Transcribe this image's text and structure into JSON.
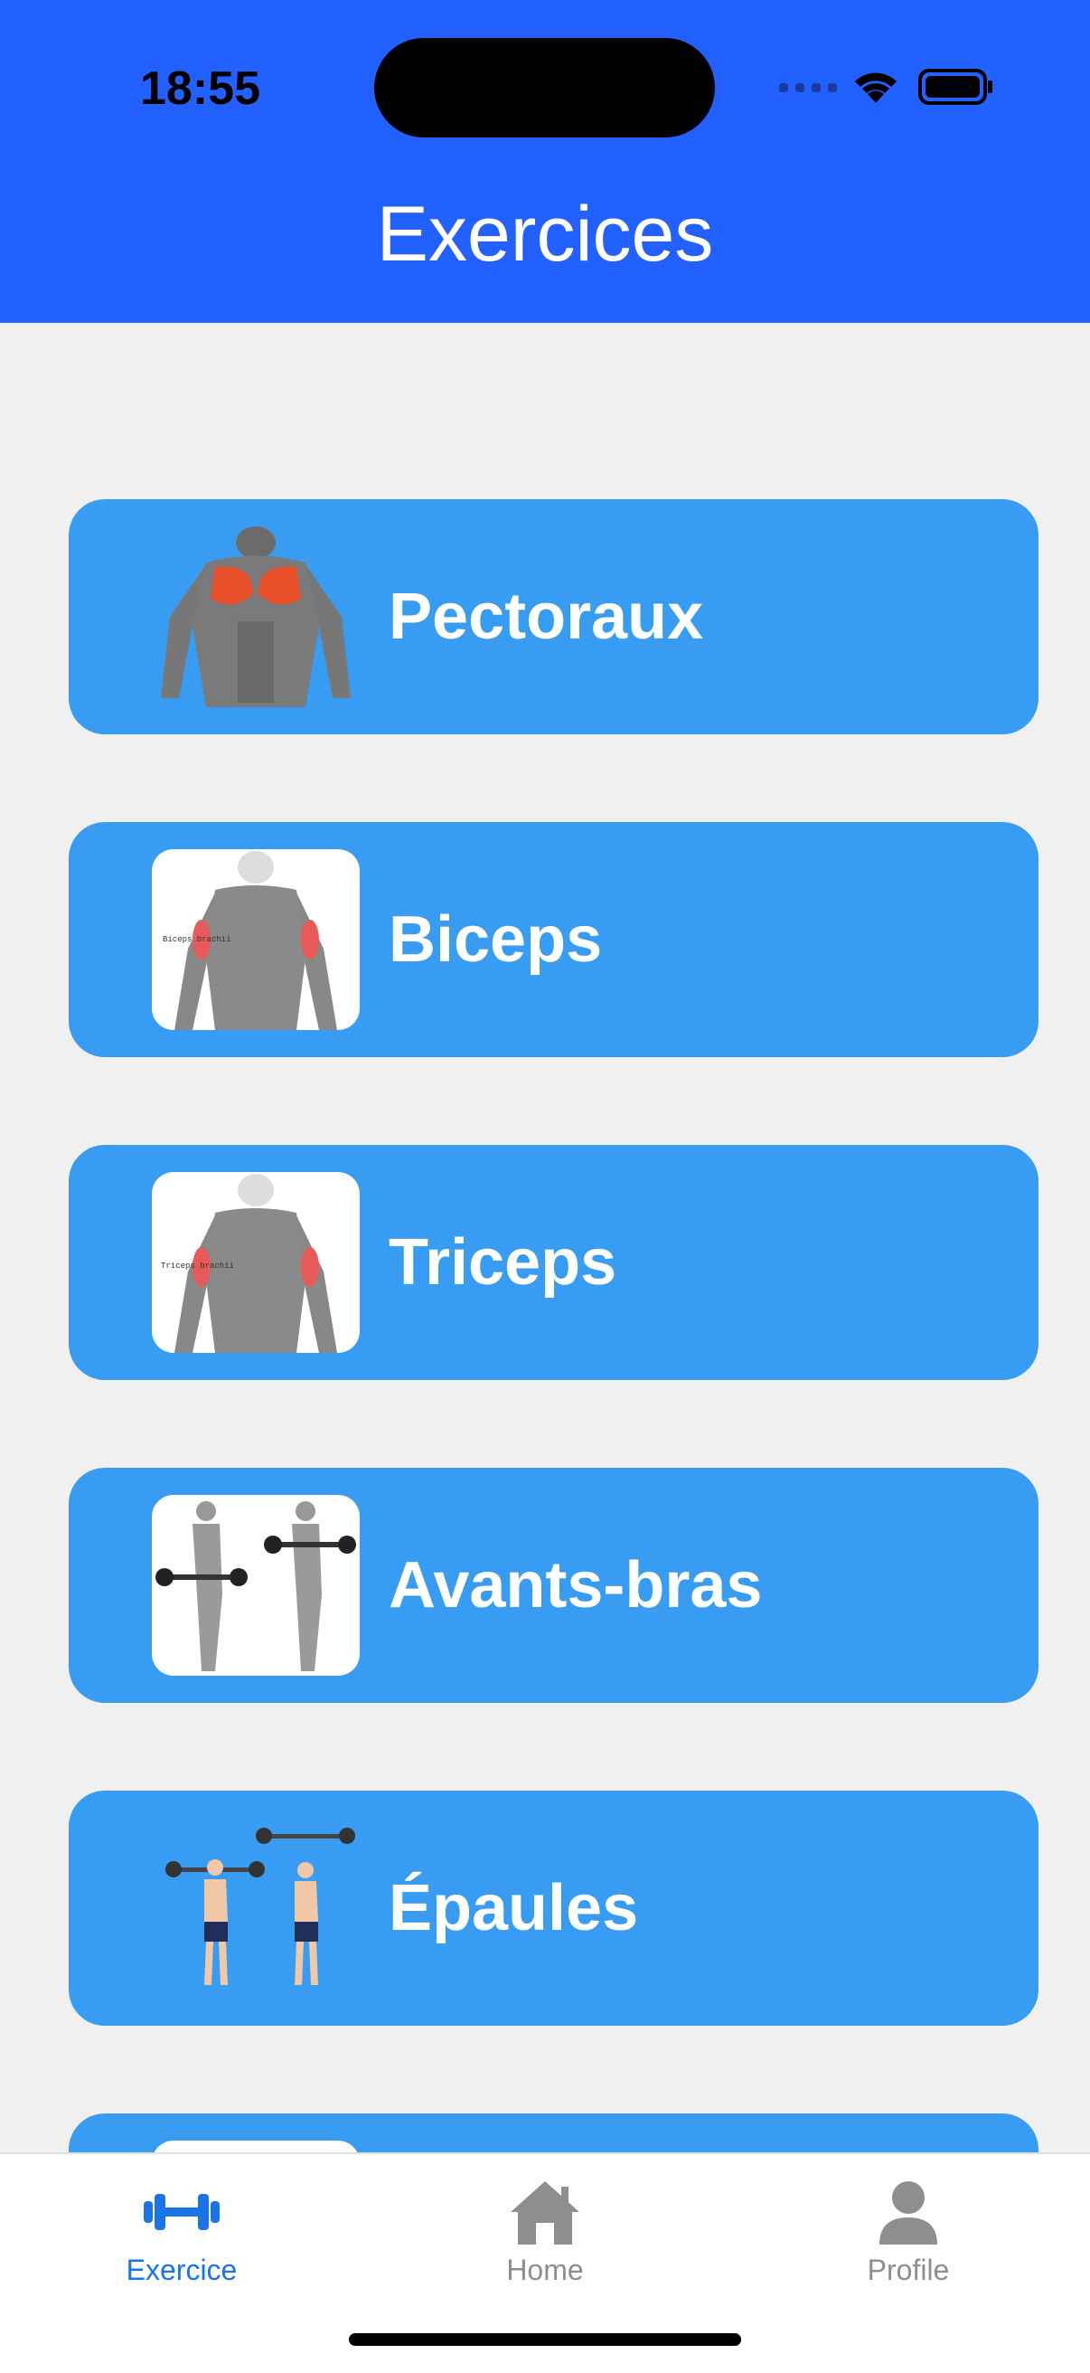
{
  "status_bar": {
    "time": "18:55"
  },
  "header": {
    "title": "Exercices"
  },
  "exercise_cards": [
    {
      "label": "Pectoraux",
      "icon": "chest-muscles-image"
    },
    {
      "label": "Biceps",
      "icon": "biceps-anatomy-image",
      "image_text": "Biceps brachii"
    },
    {
      "label": "Triceps",
      "icon": "triceps-anatomy-image",
      "image_text": "Triceps brachii"
    },
    {
      "label": "Avants-bras",
      "icon": "forearm-curl-image"
    },
    {
      "label": "Épaules",
      "icon": "shoulder-press-image"
    }
  ],
  "tabbar": {
    "items": [
      {
        "label": "Exercice",
        "icon": "dumbbell-icon",
        "active": true
      },
      {
        "label": "Home",
        "icon": "house-icon",
        "active": false
      },
      {
        "label": "Profile",
        "icon": "person-icon",
        "active": false
      }
    ]
  },
  "colors": {
    "header": "#2260ff",
    "card": "#379cf2",
    "background": "#f0f0f0",
    "tab_active": "#1a73e8",
    "tab_inactive": "#8e8e8e"
  }
}
